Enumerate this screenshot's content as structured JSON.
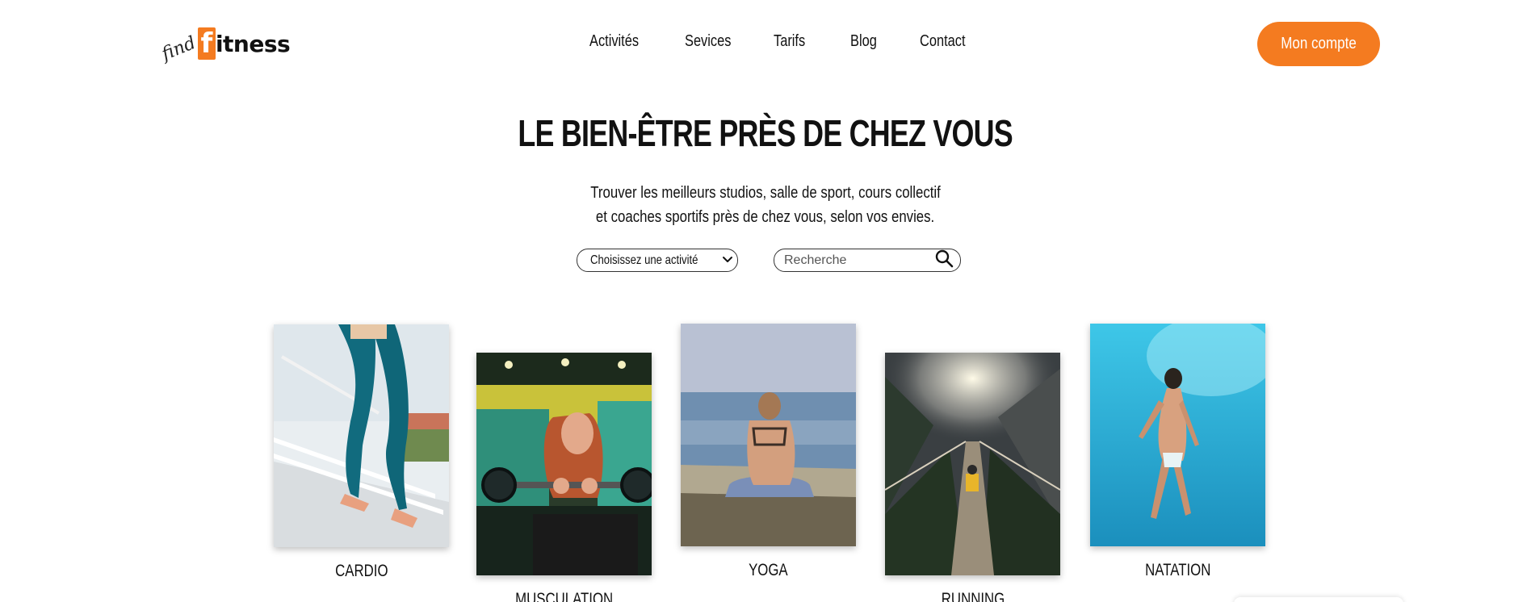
{
  "brand": {
    "logo_find": "find",
    "logo_f": "f",
    "logo_rest": "itness",
    "accent_color": "#f47b20"
  },
  "nav": {
    "items": [
      {
        "label": "Activités"
      },
      {
        "label": "Sevices"
      },
      {
        "label": "Tarifs"
      },
      {
        "label": "Blog"
      },
      {
        "label": "Contact"
      }
    ],
    "account_label": "Mon compte"
  },
  "hero": {
    "title": "LE BIEN-ÊTRE PRÈS DE CHEZ VOUS",
    "subtitle_line1": "Trouver les meilleurs studios, salle de sport, cours collectif",
    "subtitle_line2": "et coaches sportifs près de chez vous, selon vos envies."
  },
  "filters": {
    "activity_select": "Choisissez une activité",
    "search_placeholder": "Recherche"
  },
  "activities": [
    {
      "label": "CARDIO",
      "icon": "cardio-photo"
    },
    {
      "label": "MUSCULATION",
      "icon": "musculation-photo"
    },
    {
      "label": "YOGA",
      "icon": "yoga-photo"
    },
    {
      "label": "RUNNING",
      "icon": "running-photo"
    },
    {
      "label": "NATATION",
      "icon": "natation-photo"
    }
  ]
}
